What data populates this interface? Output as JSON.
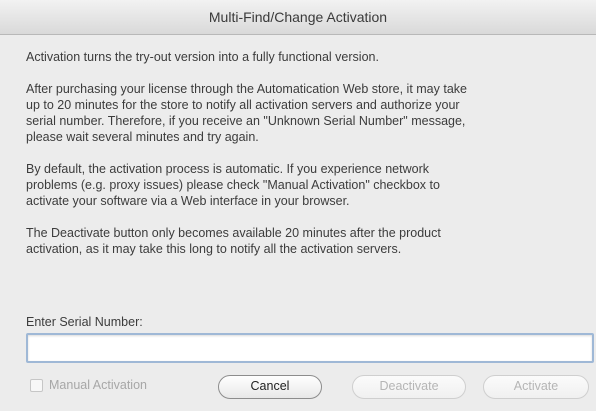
{
  "window": {
    "title": "Multi-Find/Change Activation"
  },
  "body": {
    "paragraph1": "Activation turns the try-out version into a fully functional version.",
    "paragraph2_lines": [
      "After purchasing your license through the Automatication Web store, it may take",
      "up to 20 minutes for the store to notify all activation servers and authorize your",
      "serial number. Therefore, if you receive an \"Unknown Serial Number\" message,",
      "please wait several minutes and try again."
    ],
    "paragraph3_lines": [
      "By default, the activation process is automatic. If you experience network",
      "problems (e.g. proxy issues) please check \"Manual Activation\" checkbox to",
      "activate your software via a Web interface in your browser."
    ],
    "paragraph4_lines": [
      "The Deactivate button only becomes available 20 minutes after the product",
      "activation, as it may take this long to notify all the activation servers."
    ]
  },
  "serial": {
    "label": "Enter Serial Number:",
    "value": "",
    "placeholder": ""
  },
  "controls": {
    "manual_activation_label": "Manual Activation",
    "manual_activation_checked": false,
    "cancel_label": "Cancel",
    "deactivate_label": "Deactivate",
    "activate_label": "Activate"
  },
  "colors": {
    "window_bg": "#ececec",
    "input_focus_border": "#9fb8d6",
    "disabled_text": "#b5b5b5"
  }
}
